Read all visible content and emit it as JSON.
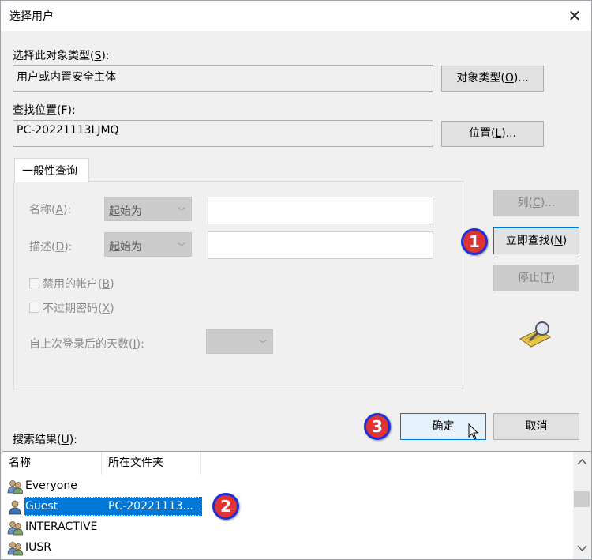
{
  "window": {
    "title": "选择用户",
    "close_glyph": "✕"
  },
  "object_type": {
    "label_prefix": "选择此对象类型(",
    "label_key": "S",
    "label_suffix": "):",
    "value": "用户或内置安全主体",
    "button_prefix": "对象类型(",
    "button_key": "O",
    "button_suffix": ")..."
  },
  "location": {
    "label_prefix": "查找位置(",
    "label_key": "F",
    "label_suffix": "):",
    "value": "PC-20221113LJMQ",
    "button_prefix": "位置(",
    "button_key": "L",
    "button_suffix": ")..."
  },
  "query": {
    "tab_label": "一般性查询",
    "name_label_prefix": "名称(",
    "name_label_key": "A",
    "name_label_suffix": "):",
    "name_mode": "起始为",
    "desc_label_prefix": "描述(",
    "desc_label_key": "D",
    "desc_label_suffix": "):",
    "desc_mode": "起始为",
    "disabled_accounts_prefix": "禁用的帐户(",
    "disabled_accounts_key": "B",
    "disabled_accounts_suffix": ")",
    "no_expire_prefix": "不过期密码(",
    "no_expire_key": "X",
    "no_expire_suffix": ")",
    "days_label_prefix": "自上次登录后的天数(",
    "days_label_key": "I",
    "days_label_suffix": "):"
  },
  "side_buttons": {
    "columns_prefix": "列(",
    "columns_key": "C",
    "columns_suffix": ")...",
    "find_now_prefix": "立即查找(",
    "find_now_key": "N",
    "find_now_suffix": ")",
    "stop_prefix": "停止(",
    "stop_key": "T",
    "stop_suffix": ")"
  },
  "ok_button": "确定",
  "cancel_button": "取消",
  "results": {
    "label_prefix": "搜索结果(",
    "label_key": "U",
    "label_suffix": "):",
    "columns": [
      "名称",
      "所在文件夹"
    ],
    "rows": [
      {
        "name": "Everyone",
        "folder": ""
      },
      {
        "name": "Guest",
        "folder": "PC-20221113..."
      },
      {
        "name": "INTERACTIVE",
        "folder": ""
      },
      {
        "name": "IUSR",
        "folder": ""
      }
    ]
  },
  "annotations": [
    "1",
    "2",
    "3"
  ],
  "colors": {
    "accent": "#0078d7",
    "badge_fill": "#e03333",
    "badge_ring": "#1d2fd8"
  }
}
